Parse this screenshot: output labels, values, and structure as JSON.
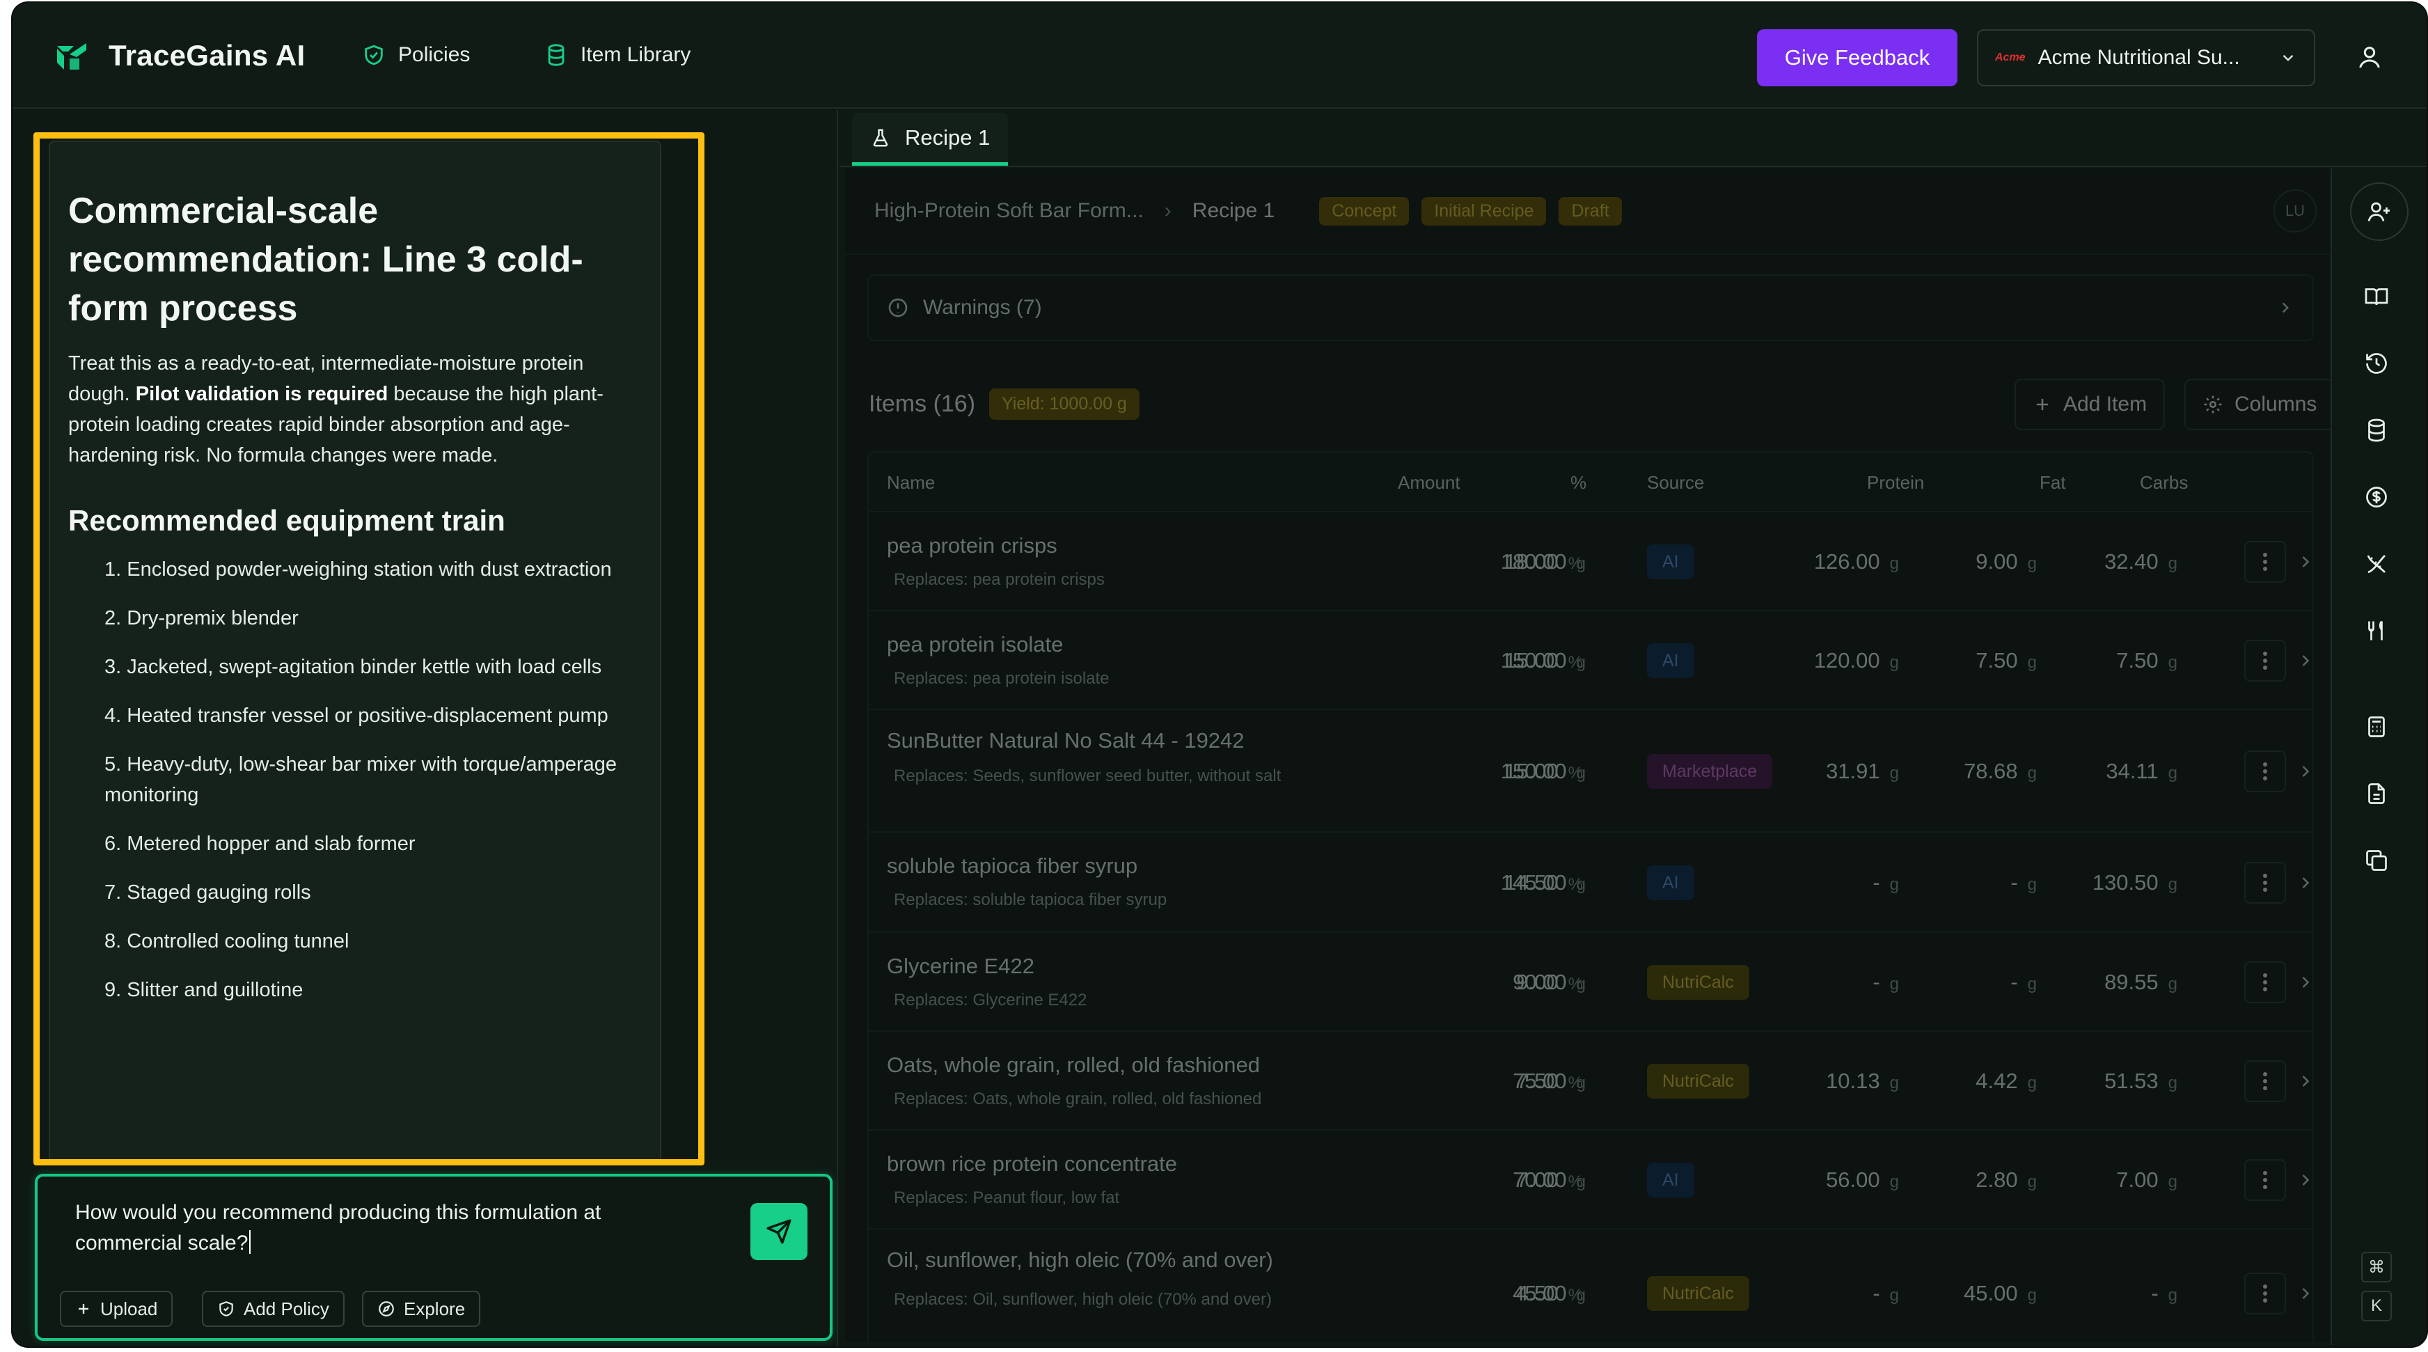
{
  "app": {
    "name": "TraceGains AI"
  },
  "nav": {
    "policies": "Policies",
    "item_library": "Item Library",
    "feedback": "Give Feedback",
    "org_logo_text": "Acme",
    "org_name": "Acme Nutritional Su..."
  },
  "chat": {
    "title": "Commercial-scale recommendation: Line 3 cold-form process",
    "intro_pre": "Treat this as a ready-to-eat, intermediate-moisture protein dough. ",
    "intro_bold": "Pilot validation is required",
    "intro_post": " because the high plant-protein loading creates rapid binder absorption and age-hardening risk. No formula changes were made.",
    "section_title": "Recommended equipment train",
    "steps": [
      "1. Enclosed powder-weighing station with dust extraction",
      "2. Dry-premix blender",
      "3. Jacketed, swept-agitation binder kettle with load cells",
      "4. Heated transfer vessel or positive-displacement pump",
      "5. Heavy-duty, low-shear bar mixer with torque/amperage monitoring",
      "6. Metered hopper and slab former",
      "7. Staged gauging rolls",
      "8. Controlled cooling tunnel",
      "9. Slitter and guillotine"
    ],
    "composer_text": "How would you recommend producing this formulation at commercial scale?",
    "upload": "Upload",
    "add_policy": "Add Policy",
    "explore": "Explore"
  },
  "recipe": {
    "tab": "Recipe 1",
    "breadcrumb_parent": "High-Protein Soft Bar Form...",
    "breadcrumb_current": "Recipe 1",
    "badges": [
      "Concept",
      "Initial Recipe",
      "Draft"
    ],
    "avatar": "LU",
    "warnings": "Warnings (7)",
    "items_label": "Items (16)",
    "yield": "Yield: 1000.00 g",
    "add_item": "Add Item",
    "columns": "Columns",
    "headers": {
      "name": "Name",
      "amount": "Amount",
      "pct": "%",
      "source": "Source",
      "protein": "Protein",
      "fat": "Fat",
      "carbs": "Carbs"
    },
    "rows": [
      {
        "name": "pea protein crisps",
        "sub": "Replaces: pea protein crisps",
        "amount": "180.00",
        "amount_unit": "g",
        "pct": "18.00",
        "pct_unit": "%",
        "source": "AI",
        "protein": "126.00",
        "fat": "9.00",
        "carbs": "32.40",
        "unit": "g"
      },
      {
        "name": "pea protein isolate",
        "sub": "Replaces: pea protein isolate",
        "amount": "150.00",
        "amount_unit": "g",
        "pct": "15.00",
        "pct_unit": "%",
        "source": "AI",
        "protein": "120.00",
        "fat": "7.50",
        "carbs": "7.50",
        "unit": "g"
      },
      {
        "name": "SunButter Natural No Salt 44 - 19242",
        "sub": "Replaces: Seeds, sunflower seed butter, without salt",
        "amount": "150.00",
        "amount_unit": "g",
        "pct": "15.00",
        "pct_unit": "%",
        "source": "Marketplace",
        "protein": "31.91",
        "fat": "78.68",
        "carbs": "34.11",
        "unit": "g"
      },
      {
        "name": "soluble tapioca fiber syrup",
        "sub": "Replaces: soluble tapioca fiber syrup",
        "amount": "145.00",
        "amount_unit": "g",
        "pct": "14.50",
        "pct_unit": "%",
        "source": "AI",
        "protein": "-",
        "fat": "-",
        "carbs": "130.50",
        "unit": "g"
      },
      {
        "name": "Glycerine E422",
        "sub": "Replaces: Glycerine E422",
        "amount": "90.00",
        "amount_unit": "g",
        "pct": "9.00",
        "pct_unit": "%",
        "source": "NutriCalc",
        "protein": "-",
        "fat": "-",
        "carbs": "89.55",
        "unit": "g"
      },
      {
        "name": "Oats, whole grain, rolled, old fashioned",
        "sub": "Replaces: Oats, whole grain, rolled, old fashioned",
        "amount": "75.00",
        "amount_unit": "g",
        "pct": "7.50",
        "pct_unit": "%",
        "source": "NutriCalc",
        "protein": "10.13",
        "fat": "4.42",
        "carbs": "51.53",
        "unit": "g"
      },
      {
        "name": "brown rice protein concentrate",
        "sub": "Replaces: Peanut flour, low fat",
        "amount": "70.00",
        "amount_unit": "g",
        "pct": "7.00",
        "pct_unit": "%",
        "source": "AI",
        "protein": "56.00",
        "fat": "2.80",
        "carbs": "7.00",
        "unit": "g"
      },
      {
        "name": "Oil, sunflower, high oleic (70% and over)",
        "sub": "Replaces: Oil, sunflower, high oleic (70% and over)",
        "amount": "45.00",
        "amount_unit": "g",
        "pct": "4.50",
        "pct_unit": "%",
        "source": "NutriCalc",
        "protein": "-",
        "fat": "45.00",
        "carbs": "-",
        "unit": "g"
      }
    ]
  },
  "shortcuts": {
    "cmd": "⌘",
    "k": "K"
  },
  "colors": {
    "brand_green": "#17cf88",
    "feedback_purple": "#7b2ff2",
    "highlight_yellow": "#ffbf10"
  }
}
